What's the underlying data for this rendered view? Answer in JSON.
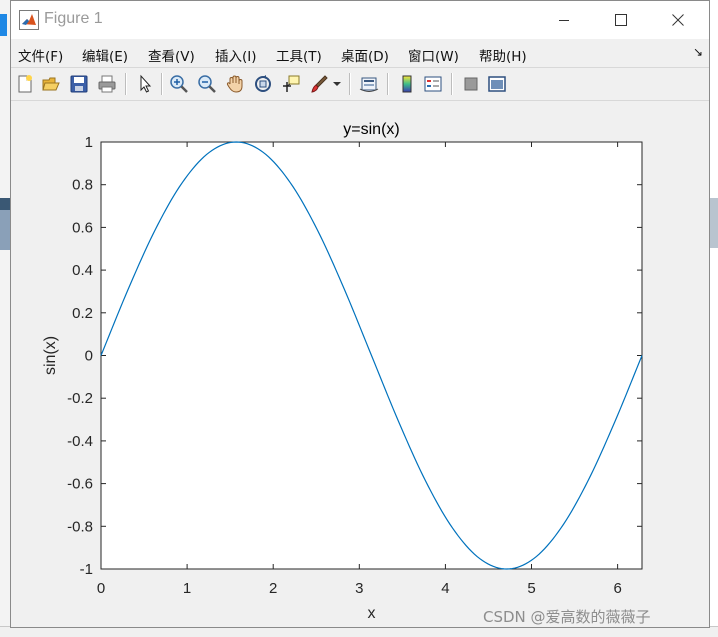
{
  "window": {
    "title": "Figure 1"
  },
  "menu": [
    {
      "label": "文件(F)"
    },
    {
      "label": "编辑(E)"
    },
    {
      "label": "查看(V)"
    },
    {
      "label": "插入(I)"
    },
    {
      "label": "工具(T)"
    },
    {
      "label": "桌面(D)"
    },
    {
      "label": "窗口(W)"
    },
    {
      "label": "帮助(H)"
    }
  ],
  "toolbar": {
    "icons": [
      "new-figure-icon",
      "open-file-icon",
      "save-icon",
      "print-icon",
      "pointer-icon",
      "zoom-in-icon",
      "zoom-out-icon",
      "pan-hand-icon",
      "rotate-3d-icon",
      "data-cursor-icon",
      "brush-icon",
      "link-plot-icon",
      "colorbar-icon",
      "legend-icon",
      "hide-plot-tools-icon",
      "show-plot-tools-icon"
    ]
  },
  "chart_data": {
    "type": "line",
    "title": "y=sin(x)",
    "xlabel": "x",
    "ylabel": "sin(x)",
    "xlim": [
      0,
      6.2832
    ],
    "ylim": [
      -1,
      1
    ],
    "xticks": [
      "0",
      "1",
      "2",
      "3",
      "4",
      "5",
      "6"
    ],
    "yticks": [
      "1",
      "0.8",
      "0.6",
      "0.4",
      "0.2",
      "0",
      "-0.2",
      "-0.4",
      "-0.6",
      "-0.8",
      "-1"
    ],
    "grid": false,
    "series": [
      {
        "color": "#0072bd",
        "x": [
          0,
          0.3142,
          0.6283,
          0.9425,
          1.2566,
          1.5708,
          1.885,
          2.1991,
          2.5133,
          2.8274,
          3.1416,
          3.4558,
          3.7699,
          4.0841,
          4.3982,
          4.7124,
          5.0265,
          5.3407,
          5.6549,
          5.969,
          6.2832
        ],
        "y": [
          0,
          0.309,
          0.5878,
          0.809,
          0.9511,
          1,
          0.9511,
          0.809,
          0.5878,
          0.309,
          0,
          -0.309,
          -0.5878,
          -0.809,
          -0.9511,
          -1,
          -0.9511,
          -0.809,
          -0.5878,
          -0.309,
          0
        ]
      }
    ]
  },
  "watermark": "CSDN @爱高数的薇薇子"
}
